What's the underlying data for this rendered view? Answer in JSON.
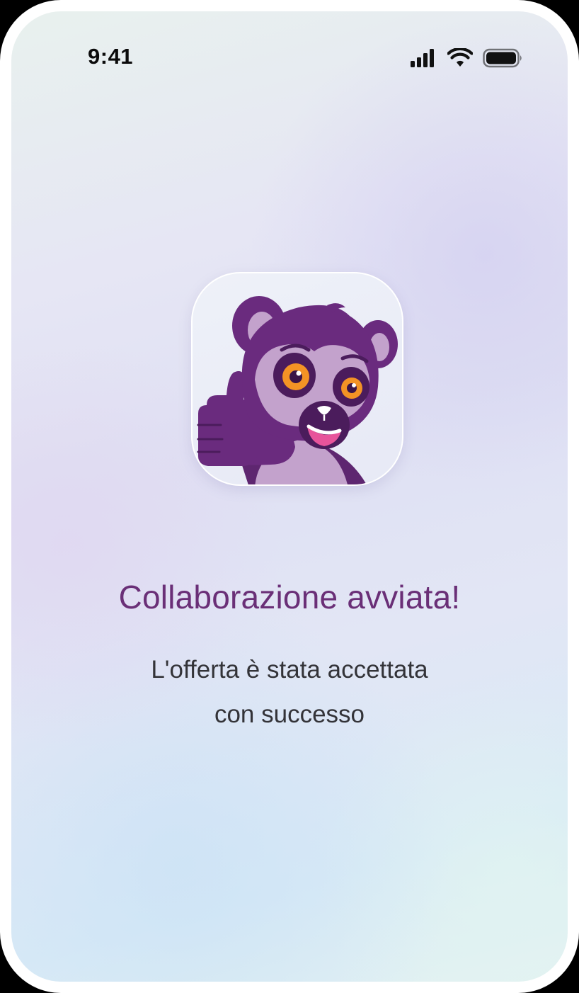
{
  "status_bar": {
    "time": "9:41",
    "icons": [
      "cellular-signal-icon",
      "wifi-icon",
      "battery-icon"
    ]
  },
  "app_icon": {
    "name": "lemur-mascot-icon"
  },
  "success": {
    "title": "Collaborazione avviata!",
    "message_line1": "L'offerta è stata accettata",
    "message_line2": "con successo"
  },
  "colors": {
    "title": "#6a2f77",
    "body_text": "#333338",
    "mascot_dark": "#6a2b7e",
    "mascot_light": "#c3a2cc",
    "eye": "#f39325"
  }
}
